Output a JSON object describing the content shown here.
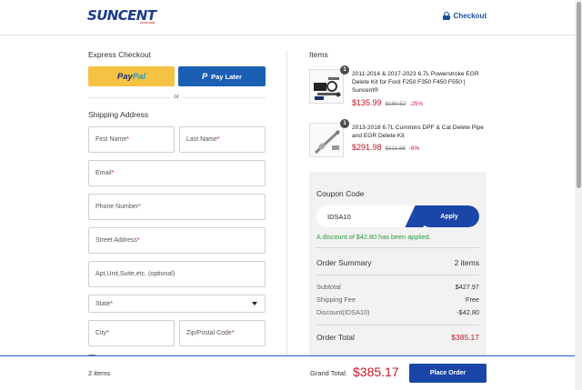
{
  "header": {
    "logo_text": "SUNCENT",
    "logo_sub": "AUTO.COM",
    "checkout_label": "Checkout"
  },
  "express": {
    "title": "Express Checkout",
    "paypal_part1": "Pay",
    "paypal_part2": "Pal",
    "paylater_icon": "P",
    "paylater_label": "Pay Later",
    "or_label": "or"
  },
  "shipping": {
    "title": "Shipping Address",
    "first_name": "First Name",
    "last_name": "Last Name",
    "email": "Email",
    "phone": "Phone Number",
    "street": "Street Address",
    "apt": "Apt,Unit,Suite,etc. (optional)",
    "state": "State",
    "city": "City",
    "zip": "Zip/Postal Code",
    "required_mark": "*"
  },
  "items": {
    "title": "Items",
    "list": [
      {
        "qty": "1",
        "name": "2011-2014 & 2017-2023 6.7L Powerstroke EGR Delete Kit for Ford F250 F350 F450 F550 | Suncent®",
        "price": "$135.99",
        "original": "$180.52",
        "discount": "-25%"
      },
      {
        "qty": "1",
        "name": "2013-2018 6.7L Cummins DPF & Cat Delete Pipe and EGR Delete Kit",
        "price": "$291.98",
        "original": "$311.88",
        "discount": "-6%"
      }
    ]
  },
  "coupon": {
    "title": "Coupon Code",
    "value": "IDSA10",
    "apply_label": "Apply",
    "message": "A discount of $42.80 has been applied."
  },
  "summary": {
    "title": "Order Summary",
    "count": "2 items",
    "subtotal_label": "Subtotal",
    "subtotal": "$427.97",
    "shipping_label": "Shipping Fee",
    "shipping": "Free",
    "discount_label": "Discount(IDSA10)",
    "discount": "-$42.80",
    "total_label": "Order Total",
    "total": "$385.17"
  },
  "footer": {
    "items_count": "2 items",
    "grand_total_label": "Grand Total:",
    "grand_total": "$385.17",
    "place_order_label": "Place Order"
  },
  "colors": {
    "brand_blue": "#1a46a8",
    "price_red": "#c4162b",
    "success_green": "#2a9b3a",
    "paypal_yellow": "#f5c244"
  }
}
